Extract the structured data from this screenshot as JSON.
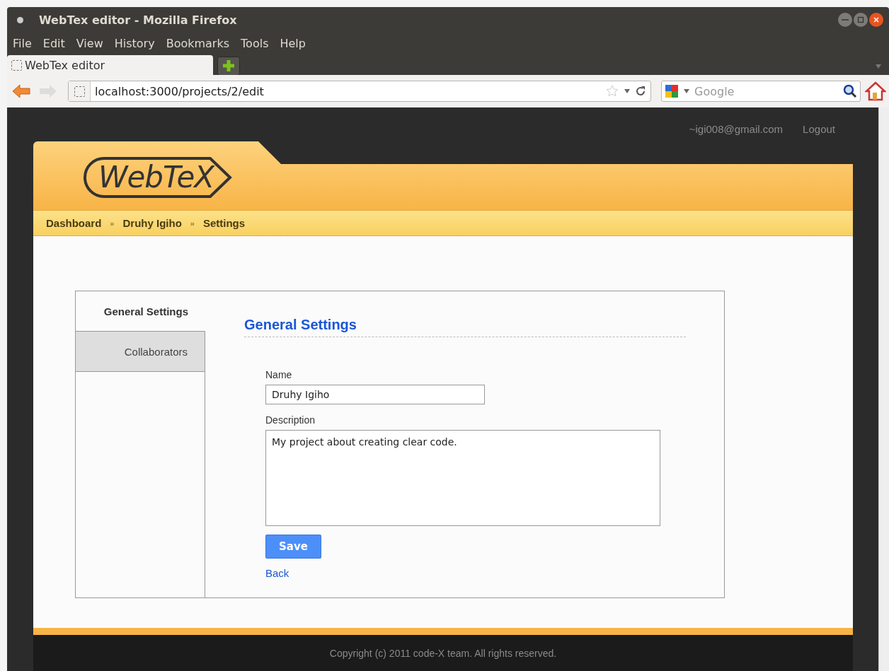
{
  "window": {
    "title": "WebTex editor - Mozilla Firefox"
  },
  "menu": [
    "File",
    "Edit",
    "View",
    "History",
    "Bookmarks",
    "Tools",
    "Help"
  ],
  "tabs": [
    {
      "label": "WebTex editor",
      "selected": true
    }
  ],
  "address_bar": {
    "value": "localhost:3000/projects/2/edit"
  },
  "search": {
    "placeholder": "Google"
  },
  "site": {
    "logo": "WebTeX",
    "user": "~igi008@gmail.com",
    "logout": "Logout",
    "breadcrumb": [
      "Dashboard",
      "Druhy Igiho",
      "Settings"
    ],
    "separator": "»",
    "side_tabs": [
      {
        "label": "General Settings",
        "selected": true
      },
      {
        "label": "Collaborators",
        "selected": false
      }
    ],
    "heading": "General Settings",
    "fields": [
      {
        "kind": "input",
        "label": "Name",
        "value": "Druhy Igiho"
      },
      {
        "kind": "textarea",
        "label": "Description",
        "value": "My project about creating clear code."
      }
    ],
    "save": "Save",
    "back": "Back",
    "footer": "Copyright (c) 2011 code-X team. All rights reserved."
  }
}
